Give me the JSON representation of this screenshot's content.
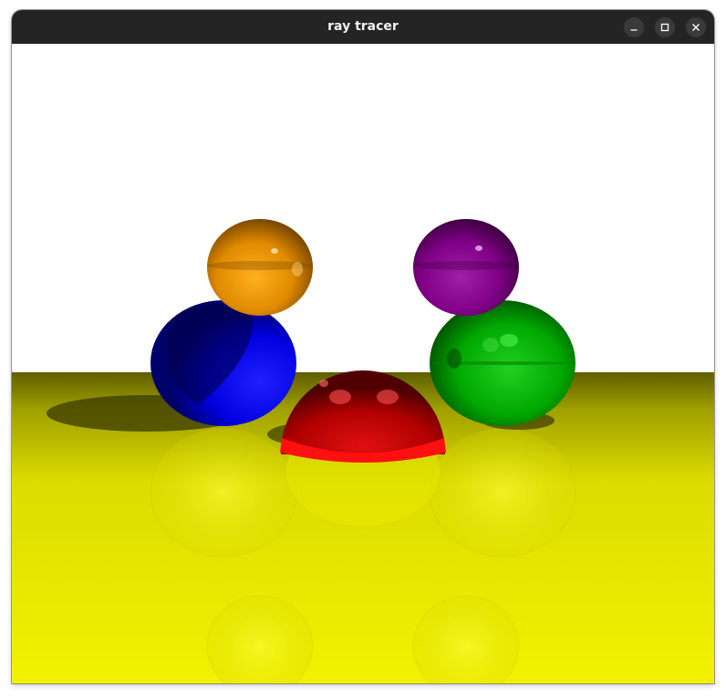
{
  "window": {
    "title": "ray tracer",
    "controls": [
      {
        "name": "minimize-button",
        "icon": "minimize-icon"
      },
      {
        "name": "maximize-button",
        "icon": "maximize-icon"
      },
      {
        "name": "close-button",
        "icon": "close-icon"
      }
    ]
  },
  "scene": {
    "background_color": "#ffffff",
    "floor_color": "#f0f000",
    "spheres": [
      {
        "name": "orange-sphere",
        "color": "#e08a00"
      },
      {
        "name": "purple-sphere",
        "color": "#8a0090"
      },
      {
        "name": "blue-sphere",
        "color": "#0000ff"
      },
      {
        "name": "green-sphere",
        "color": "#00b000"
      },
      {
        "name": "red-sphere",
        "color": "#e00000"
      }
    ]
  }
}
